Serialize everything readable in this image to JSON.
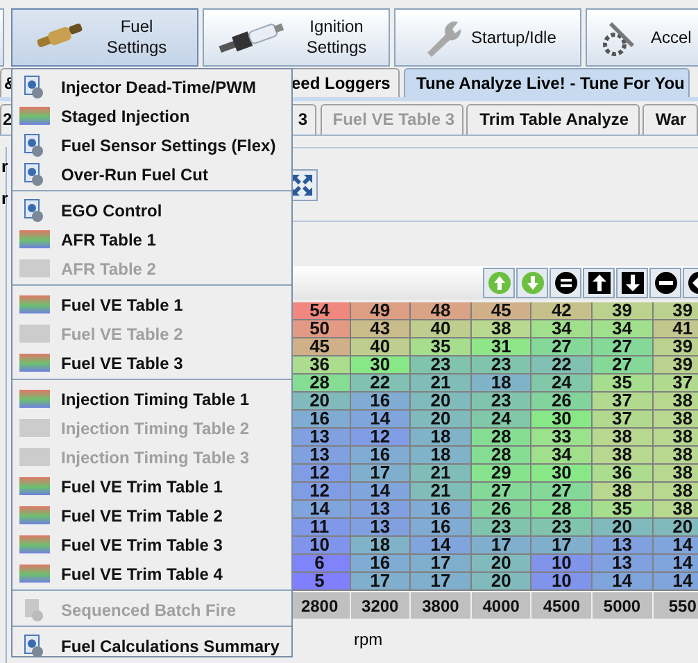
{
  "toolbar": [
    {
      "label": "Fuel Settings",
      "selected": true
    },
    {
      "label": "Ignition Settings",
      "selected": false
    },
    {
      "label": "Startup/Idle",
      "selected": false
    },
    {
      "label": "Accel",
      "selected": false
    }
  ],
  "tabs_row_1": [
    {
      "label": "&",
      "selected": false
    },
    {
      "label": "eed Loggers",
      "selected": false
    },
    {
      "label": "Tune Analyze Live! - Tune For You",
      "selected": true
    }
  ],
  "tabs_row_2": [
    {
      "label": "2",
      "disabled": false
    },
    {
      "label": "3",
      "disabled": false
    },
    {
      "label": "Fuel VE Table 3",
      "disabled": true
    },
    {
      "label": "Trim Table Analyze",
      "disabled": false
    },
    {
      "label": "War",
      "disabled": false
    }
  ],
  "side_letters": [
    "r",
    "r"
  ],
  "table": {
    "rows": [
      [
        "54",
        "49",
        "48",
        "45",
        "42",
        "39",
        "39"
      ],
      [
        "50",
        "43",
        "40",
        "38",
        "34",
        "34",
        "41"
      ],
      [
        "45",
        "40",
        "35",
        "31",
        "27",
        "27",
        "39"
      ],
      [
        "36",
        "30",
        "23",
        "23",
        "22",
        "27",
        "39"
      ],
      [
        "28",
        "22",
        "21",
        "18",
        "24",
        "35",
        "37"
      ],
      [
        "20",
        "16",
        "20",
        "23",
        "26",
        "37",
        "38"
      ],
      [
        "16",
        "14",
        "20",
        "24",
        "30",
        "37",
        "38"
      ],
      [
        "13",
        "12",
        "18",
        "28",
        "33",
        "38",
        "38"
      ],
      [
        "13",
        "16",
        "18",
        "28",
        "34",
        "38",
        "38"
      ],
      [
        "12",
        "17",
        "21",
        "29",
        "30",
        "36",
        "38"
      ],
      [
        "12",
        "14",
        "21",
        "27",
        "27",
        "38",
        "38"
      ],
      [
        "14",
        "13",
        "16",
        "26",
        "28",
        "35",
        "38"
      ],
      [
        "11",
        "13",
        "16",
        "23",
        "23",
        "20",
        "20"
      ],
      [
        "10",
        "18",
        "14",
        "17",
        "17",
        "13",
        "14"
      ],
      [
        "6",
        "16",
        "17",
        "20",
        "10",
        "13",
        "14"
      ],
      [
        "5",
        "17",
        "17",
        "20",
        "10",
        "14",
        "14"
      ]
    ],
    "rpm_axis": [
      "2800",
      "3200",
      "3800",
      "4000",
      "4500",
      "5000",
      "550"
    ],
    "axis_label": "rpm"
  },
  "menu": [
    {
      "kind": "dialog",
      "label": "Injector Dead-Time/PWM",
      "disabled": false
    },
    {
      "kind": "table",
      "label": "Staged Injection",
      "disabled": false
    },
    {
      "kind": "dialog",
      "label": "Fuel Sensor Settings (Flex)",
      "disabled": false
    },
    {
      "kind": "dialog",
      "label": "Over-Run Fuel Cut",
      "disabled": false
    },
    {
      "kind": "separator"
    },
    {
      "kind": "dialog",
      "label": "EGO Control",
      "disabled": false
    },
    {
      "kind": "table",
      "label": "AFR Table 1",
      "disabled": false
    },
    {
      "kind": "table",
      "label": "AFR Table 2",
      "disabled": true
    },
    {
      "kind": "separator"
    },
    {
      "kind": "table",
      "label": "Fuel VE Table 1",
      "disabled": false
    },
    {
      "kind": "table",
      "label": "Fuel VE Table 2",
      "disabled": true
    },
    {
      "kind": "table",
      "label": "Fuel VE Table 3",
      "disabled": false
    },
    {
      "kind": "separator"
    },
    {
      "kind": "table",
      "label": "Injection Timing Table 1",
      "disabled": false
    },
    {
      "kind": "table",
      "label": "Injection Timing Table 2",
      "disabled": true
    },
    {
      "kind": "table",
      "label": "Injection Timing Table 3",
      "disabled": true
    },
    {
      "kind": "table",
      "label": "Fuel VE Trim Table 1",
      "disabled": false
    },
    {
      "kind": "table",
      "label": "Fuel VE Trim Table 2",
      "disabled": false
    },
    {
      "kind": "table",
      "label": "Fuel VE Trim Table 3",
      "disabled": false
    },
    {
      "kind": "table",
      "label": "Fuel VE Trim Table 4",
      "disabled": false
    },
    {
      "kind": "separator"
    },
    {
      "kind": "dialog",
      "label": "Sequenced Batch Fire",
      "disabled": true
    },
    {
      "kind": "separator"
    },
    {
      "kind": "dialog",
      "label": "Fuel Calculations Summary",
      "disabled": false
    }
  ]
}
